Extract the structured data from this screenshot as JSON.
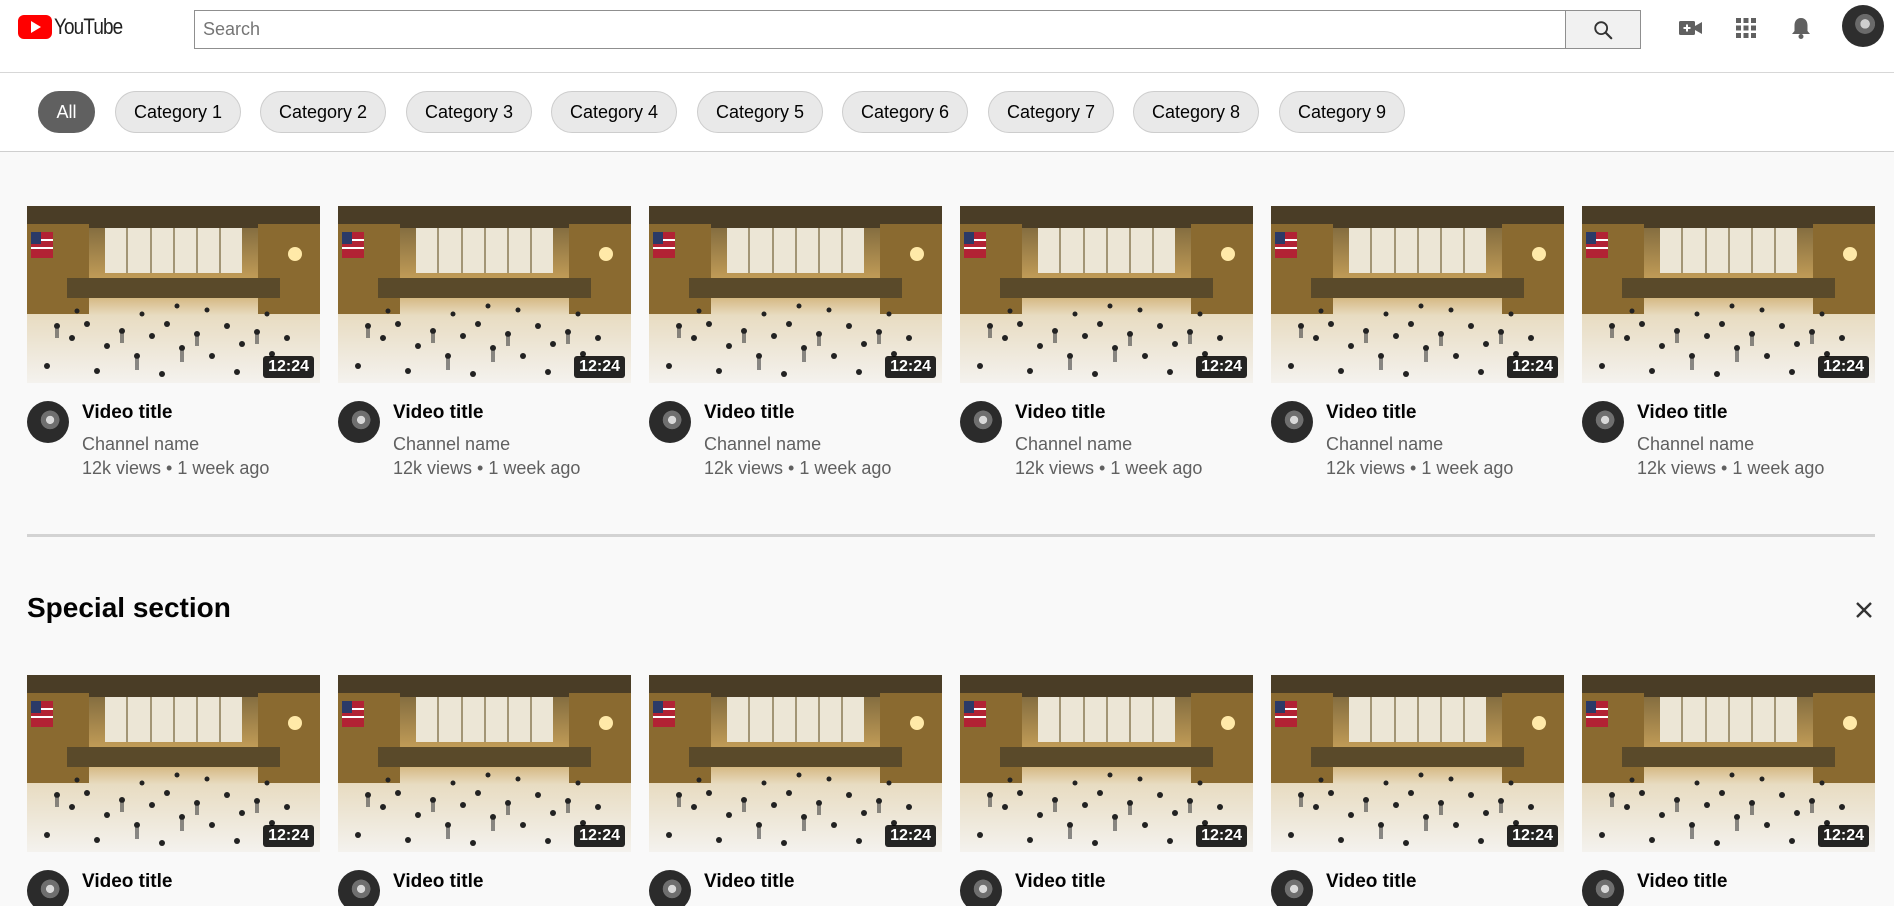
{
  "header": {
    "logo_text": "YouTube",
    "search_placeholder": "Search",
    "search_value": "",
    "icons": [
      "create-video-icon",
      "apps-grid-icon",
      "notifications-bell-icon"
    ],
    "brand_color": "#ff0000"
  },
  "chips": [
    "All",
    "Category 1",
    "Category 2",
    "Category 3",
    "Category 4",
    "Category 5",
    "Category 6",
    "Category 7",
    "Category 8",
    "Category 9"
  ],
  "active_chip": "All",
  "grid": {
    "videos": [
      {
        "title": "Video title",
        "channel": "Channel name",
        "stats": "12k views • 1 week ago",
        "duration": "12:24"
      },
      {
        "title": "Video title",
        "channel": "Channel name",
        "stats": "12k views • 1 week ago",
        "duration": "12:24"
      },
      {
        "title": "Video title",
        "channel": "Channel name",
        "stats": "12k views • 1 week ago",
        "duration": "12:24"
      },
      {
        "title": "Video title",
        "channel": "Channel name",
        "stats": "12k views • 1 week ago",
        "duration": "12:24"
      },
      {
        "title": "Video title",
        "channel": "Channel name",
        "stats": "12k views • 1 week ago",
        "duration": "12:24"
      },
      {
        "title": "Video title",
        "channel": "Channel name",
        "stats": "12k views • 1 week ago",
        "duration": "12:24"
      }
    ]
  },
  "special_section": {
    "title": "Special section",
    "close_icon": "close-icon",
    "videos": [
      {
        "title": "Video title",
        "duration": "12:24"
      },
      {
        "title": "Video title",
        "duration": "12:24"
      },
      {
        "title": "Video title",
        "duration": "12:24"
      },
      {
        "title": "Video title",
        "duration": "12:24"
      },
      {
        "title": "Video title",
        "duration": "12:24"
      },
      {
        "title": "Video title",
        "duration": "12:24"
      }
    ]
  }
}
